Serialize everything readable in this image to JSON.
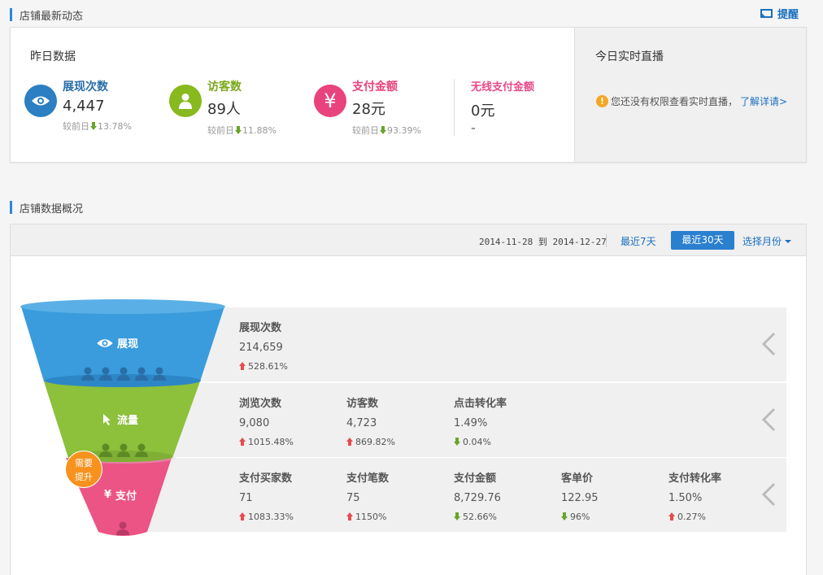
{
  "section1": {
    "title": "店铺最新动态",
    "remind": "提醒"
  },
  "yesterday": {
    "title": "昨日数据",
    "metrics": [
      {
        "label": "展现次数",
        "value": "4,447",
        "compare_prefix": "较前日",
        "compare": "13.78%",
        "color": "#2b7fc2",
        "icon": "eye-icon"
      },
      {
        "label": "访客数",
        "value": "89人",
        "compare_prefix": "较前日",
        "compare": "11.88%",
        "color": "#88b91e",
        "icon": "user-icon"
      },
      {
        "label": "支付金额",
        "value": "28元",
        "compare_prefix": "较前日",
        "compare": "93.39%",
        "color": "#e8437c",
        "icon": "yen-icon"
      }
    ],
    "wireless": {
      "label": "无线支付金额",
      "value": "0元",
      "compare": "-"
    }
  },
  "live": {
    "title": "今日实时直播",
    "warning": "您还没有权限查看实时直播，",
    "link": "了解详请",
    "link_arrow": ">"
  },
  "section2": {
    "title": "店铺数据概况"
  },
  "toolbar": {
    "date_from": "2014-11-28",
    "to_word": "到",
    "date_to": "2014-12-27",
    "btn_7": "最近7天",
    "btn_30": "最近30天",
    "btn_month": "选择月份"
  },
  "funnel": {
    "stages": [
      {
        "label": "展现",
        "color": "#3a9cdc"
      },
      {
        "label": "流量",
        "color": "#8dc03b"
      },
      {
        "label": "支付",
        "color": "#ec5486"
      }
    ],
    "badge": [
      "需要",
      "提升"
    ]
  },
  "bands": [
    {
      "columns": [
        {
          "label": "展现次数",
          "value": "214,659",
          "change": "528.61%",
          "dir": "up"
        }
      ]
    },
    {
      "columns": [
        {
          "label": "浏览次数",
          "value": "9,080",
          "change": "1015.48%",
          "dir": "up"
        },
        {
          "label": "访客数",
          "value": "4,723",
          "change": "869.82%",
          "dir": "up"
        },
        {
          "label": "点击转化率",
          "value": "1.49%",
          "change": "0.04%",
          "dir": "down"
        }
      ]
    },
    {
      "columns": [
        {
          "label": "支付买家数",
          "value": "71",
          "change": "1083.33%",
          "dir": "up"
        },
        {
          "label": "支付笔数",
          "value": "75",
          "change": "1150%",
          "dir": "up"
        },
        {
          "label": "支付金额",
          "value": "8,729.76",
          "change": "52.66%",
          "dir": "down"
        },
        {
          "label": "客单价",
          "value": "122.95",
          "change": "96%",
          "dir": "down"
        },
        {
          "label": "支付转化率",
          "value": "1.50%",
          "change": "0.27%",
          "dir": "up"
        }
      ]
    }
  ]
}
